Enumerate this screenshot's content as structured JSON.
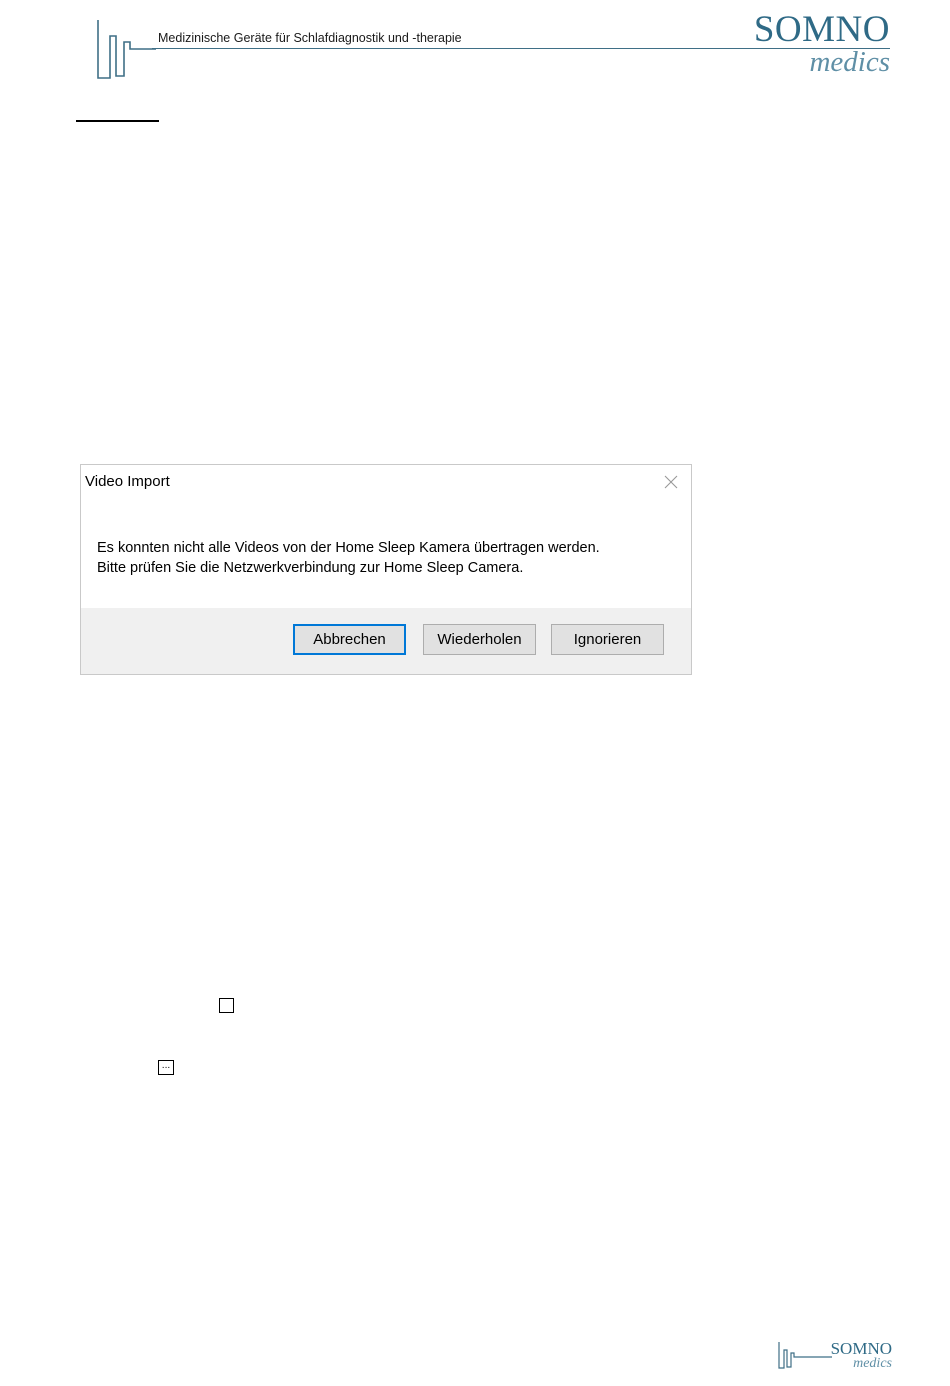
{
  "header": {
    "tagline": "Medizinische Geräte für Schlafdiagnostik und -therapie",
    "brand_top": "SOMNO",
    "brand_bottom": "medics",
    "accent_color": "#2f6a86"
  },
  "dialog": {
    "title": "Video Import",
    "close_icon": "close-icon",
    "message_line1": "Es konnten nicht alle Videos von der Home Sleep Kamera übertragen werden.",
    "message_line2": "Bitte prüfen Sie die Netzwerkverbindung zur Home Sleep Camera.",
    "buttons": {
      "abort": "Abbrechen",
      "retry": "Wiederholen",
      "ignore": "Ignorieren"
    },
    "default_button_color": "#0078d7"
  },
  "inline_icons": {
    "checkbox": "checkbox-icon",
    "ellipsis_button": "..."
  },
  "footer": {
    "brand_top": "SOMNO",
    "brand_bottom": "medics"
  }
}
